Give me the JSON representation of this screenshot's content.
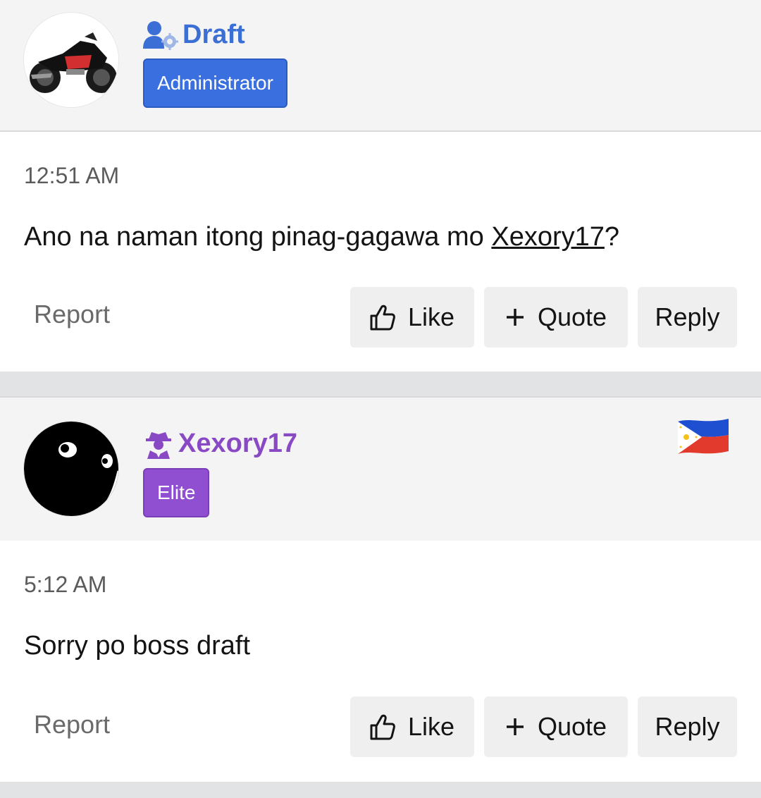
{
  "posts": [
    {
      "username": "Draft",
      "role": "Administrator",
      "user_icon": "admin-user-gear-icon",
      "time": "12:51 AM",
      "message_prefix": "Ano na naman itong pinag-gagawa mo ",
      "mention": "Xexory17",
      "message_suffix": "?",
      "report": "Report",
      "like": "Like",
      "quote": "Quote",
      "reply": "Reply"
    },
    {
      "username": "Xexory17",
      "role": "Elite",
      "user_icon": "spy-user-icon",
      "flag": "philippines-flag-icon",
      "time": "5:12 AM",
      "message": "Sorry po boss draft",
      "report": "Report",
      "like": "Like",
      "quote": "Quote",
      "reply": "Reply"
    }
  ],
  "colors": {
    "admin_blue": "#3b6fd6",
    "elite_purple": "#8a49c4",
    "button_bg": "#efefef",
    "header_bg": "#f4f4f5",
    "page_bg": "#e2e3e4"
  }
}
